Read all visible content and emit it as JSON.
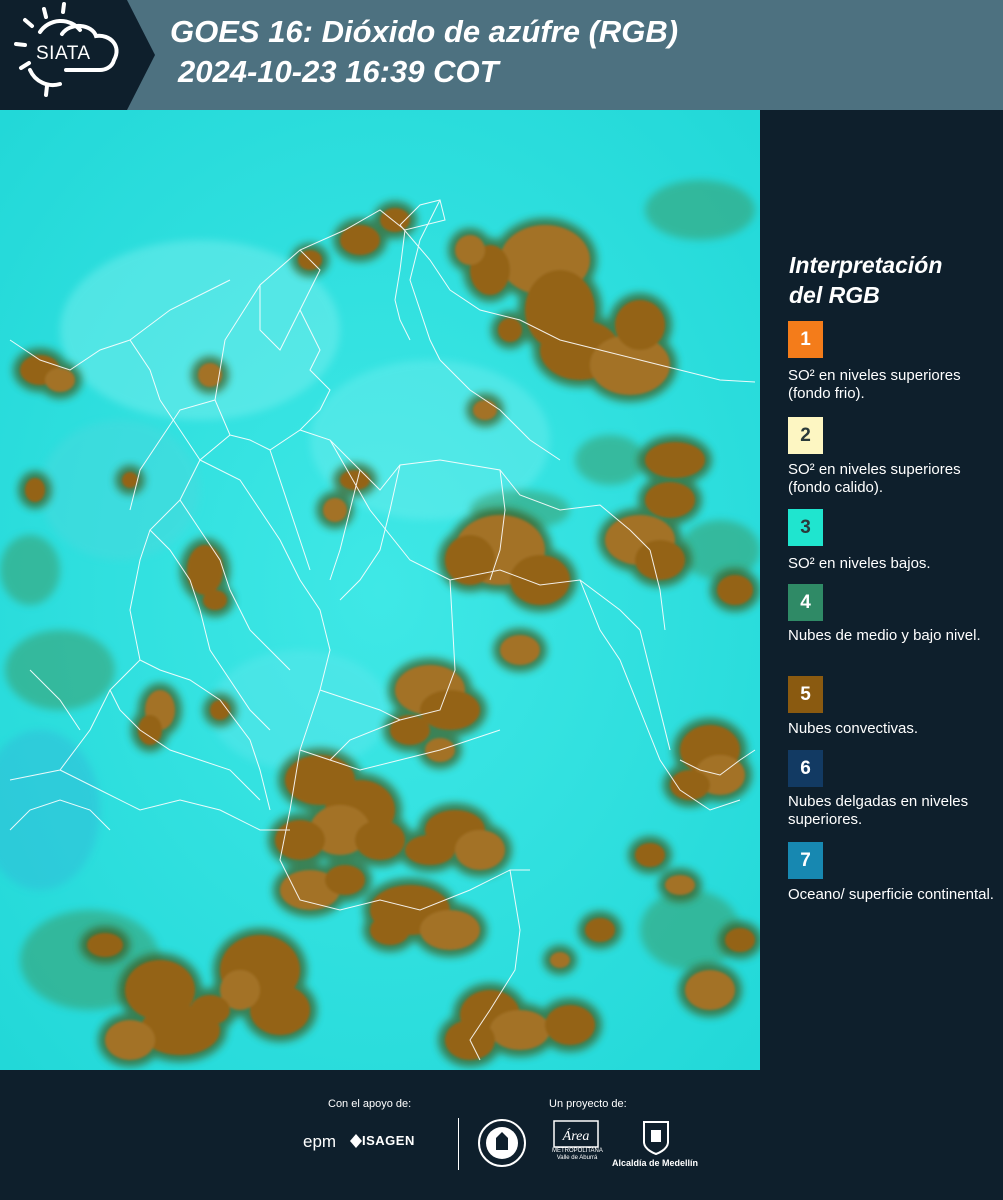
{
  "header": {
    "logo_text": "SIATA",
    "title_line1": "GOES 16: Dióxido de azúfre (RGB)",
    "title_line2": "2024-10-23 16:39 COT"
  },
  "legend": {
    "title_line1": "Interpretación",
    "title_line2": "del RGB",
    "items": [
      {
        "num": "1",
        "color": "#f47c1a",
        "text": "SO² en niveles superiores (fondo frio)."
      },
      {
        "num": "2",
        "color": "#fdf6c2",
        "text": "SO² en niveles superiores (fondo calido)."
      },
      {
        "num": "3",
        "color": "#1fe5cf",
        "text": "SO² en niveles bajos."
      },
      {
        "num": "4",
        "color": "#2f8a66",
        "text": "Nubes de medio y bajo nivel."
      },
      {
        "num": "5",
        "color": "#8a5a10",
        "text": "Nubes convectivas."
      },
      {
        "num": "6",
        "color": "#123a63",
        "text": "Nubes delgadas en niveles superiores."
      },
      {
        "num": "7",
        "color": "#1788b1",
        "text": "Oceano/ superficie continental."
      }
    ]
  },
  "map": {
    "background_color": "#27e6e3",
    "cloud_color": "#9a6a1f",
    "cloud_edge_color": "#4a5a1e",
    "border_color": "#ffffff"
  },
  "footer": {
    "support_label": "Con el apoyo de:",
    "project_label": "Un proyecto de:",
    "epm": "epm",
    "isagen": "ISAGEN",
    "area_metropolitana_logo": "Área",
    "area_metropolitana_sub": "METROPOLITANA Valle de Aburrá",
    "alcaldia": "Alcaldía de Medellín"
  }
}
